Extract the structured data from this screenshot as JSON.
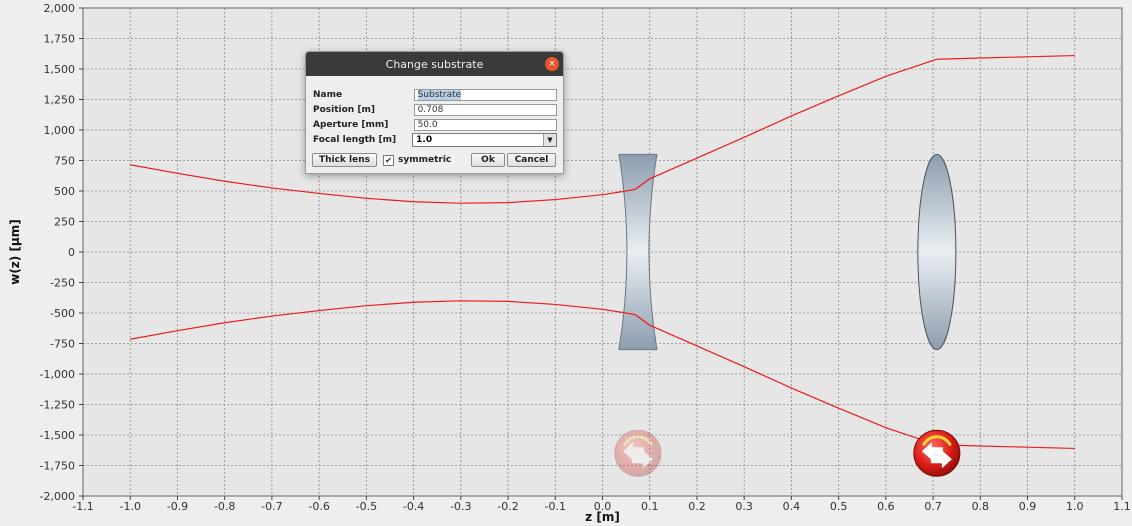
{
  "chart_data": {
    "type": "line",
    "xlabel": "z [m]",
    "ylabel": "w(z) [µm]",
    "xlim": [
      -1.1,
      1.1
    ],
    "ylim": [
      -2000,
      2000
    ],
    "x_ticks": [
      -1.1,
      -1.0,
      -0.9,
      -0.8,
      -0.7,
      -0.6,
      -0.5,
      -0.4,
      -0.3,
      -0.2,
      -0.1,
      0.0,
      0.1,
      0.2,
      0.3,
      0.4,
      0.5,
      0.6,
      0.7,
      0.8,
      0.9,
      1.0,
      1.1
    ],
    "x_tick_labels": [
      "-1.1",
      "-1.0",
      "-0.9",
      "-0.8",
      "-0.7",
      "-0.6",
      "-0.5",
      "-0.4",
      "-0.3",
      "-0.2",
      "-0.1",
      "0.0",
      "0.1",
      "0.2",
      "0.3",
      "0.4",
      "0.5",
      "0.6",
      "0.7",
      "0.8",
      "0.9",
      "1.0",
      "1.1"
    ],
    "y_ticks": [
      2000,
      1750,
      1500,
      1250,
      1000,
      750,
      500,
      250,
      0,
      -250,
      -500,
      -750,
      -1000,
      -1250,
      -1500,
      -1750,
      -2000
    ],
    "y_tick_labels": [
      "2,000",
      "1,750",
      "1,500",
      "1,250",
      "1,000",
      "750",
      "500",
      "250",
      "0",
      "-250",
      "-500",
      "-750",
      "-1,000",
      "-1,250",
      "-1,500",
      "-1,750",
      "-2,000"
    ],
    "grid": true,
    "series": [
      {
        "color": "#ee1c1c",
        "x": [
          -1.0,
          -0.9,
          -0.8,
          -0.7,
          -0.6,
          -0.5,
          -0.4,
          -0.3,
          -0.2,
          -0.1,
          0.0,
          0.05,
          0.07,
          0.1,
          0.2,
          0.3,
          0.4,
          0.5,
          0.6,
          0.7,
          0.708,
          0.8,
          0.9,
          1.0
        ],
        "y": [
          715,
          645,
          580,
          525,
          480,
          440,
          412,
          400,
          405,
          430,
          470,
          500,
          515,
          600,
          770,
          940,
          1115,
          1280,
          1440,
          1570,
          1580,
          1590,
          1600,
          1610
        ]
      },
      {
        "color": "#ee1c1c",
        "x": [
          -1.0,
          -0.9,
          -0.8,
          -0.7,
          -0.6,
          -0.5,
          -0.4,
          -0.3,
          -0.2,
          -0.1,
          0.0,
          0.05,
          0.07,
          0.1,
          0.2,
          0.3,
          0.4,
          0.5,
          0.6,
          0.7,
          0.708,
          0.8,
          0.9,
          1.0
        ],
        "y": [
          -715,
          -645,
          -580,
          -525,
          -480,
          -440,
          -412,
          -400,
          -405,
          -430,
          -470,
          -500,
          -515,
          -600,
          -770,
          -940,
          -1115,
          -1280,
          -1440,
          -1570,
          -1580,
          -1590,
          -1600,
          -1610
        ]
      }
    ],
    "elements": [
      {
        "kind": "concave-lens",
        "z": 0.075,
        "aperture": 800
      },
      {
        "kind": "convex-lens",
        "z": 0.708,
        "aperture": 800
      }
    ],
    "markers": [
      {
        "kind": "substrate-handle",
        "z": 0.075,
        "w": -1650,
        "state": "inactive"
      },
      {
        "kind": "substrate-handle",
        "z": 0.708,
        "w": -1650,
        "state": "active"
      }
    ]
  },
  "dialog": {
    "title": "Change substrate",
    "close_label": "×",
    "fields": {
      "name_label": "Name",
      "name_value": "Substrate",
      "position_label": "Position [m]",
      "position_value": "0.708",
      "aperture_label": "Aperture [mm]",
      "aperture_value": "50.0",
      "focal_label": "Focal length [m]",
      "focal_value": "1.0",
      "combo_arrow": "▼"
    },
    "thick_lens_label": "Thick lens",
    "symmetric_label": "symmetric",
    "symmetric_check": "✔",
    "ok_label": "Ok",
    "cancel_label": "Cancel"
  }
}
